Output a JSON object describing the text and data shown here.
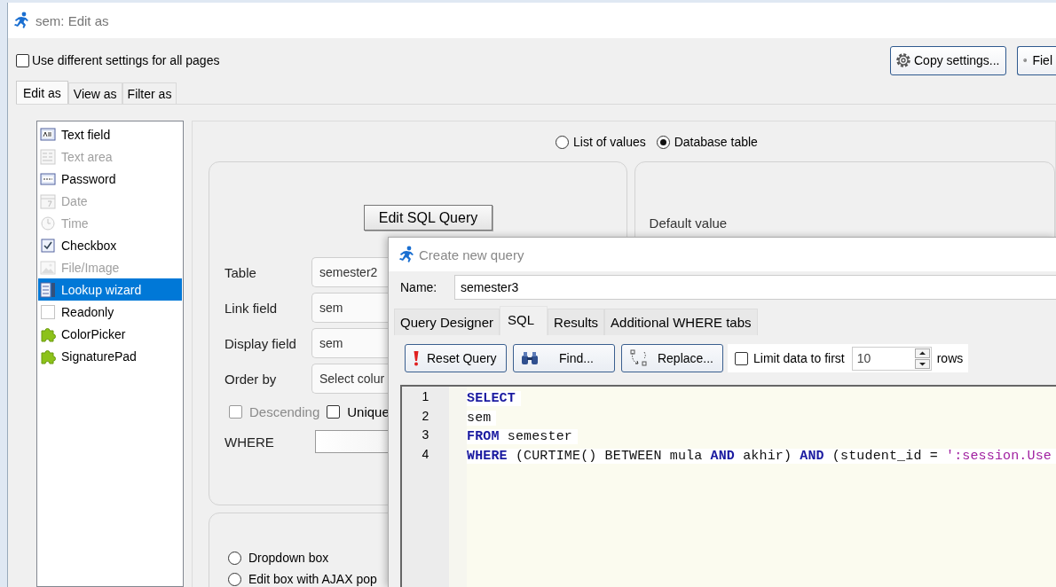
{
  "window": {
    "title": "sem: Edit as"
  },
  "use_different_settings": {
    "label": "Use different settings for all pages",
    "checked": false
  },
  "toolbar_buttons": [
    {
      "label": "Copy settings...",
      "kind": "gear"
    },
    {
      "label": "Fiel",
      "kind": "light"
    }
  ],
  "tabs": [
    {
      "label": "Edit as",
      "selected": true
    },
    {
      "label": "View as",
      "selected": false
    },
    {
      "label": "Filter as",
      "selected": false
    }
  ],
  "edit_types": [
    {
      "label": "Text field",
      "kind": "textfield",
      "disabled": false,
      "selected": false
    },
    {
      "label": "Text area",
      "kind": "textarea",
      "disabled": true,
      "selected": false
    },
    {
      "label": "Password",
      "kind": "password",
      "disabled": false,
      "selected": false
    },
    {
      "label": "Date",
      "kind": "date",
      "disabled": true,
      "selected": false
    },
    {
      "label": "Time",
      "kind": "time",
      "disabled": true,
      "selected": false
    },
    {
      "label": "Checkbox",
      "kind": "checkbox",
      "disabled": false,
      "selected": false
    },
    {
      "label": "File/Image",
      "kind": "image",
      "disabled": true,
      "selected": false
    },
    {
      "label": "Lookup wizard",
      "kind": "lookup",
      "disabled": false,
      "selected": true
    },
    {
      "label": "Readonly",
      "kind": "readonly",
      "disabled": false,
      "selected": false
    },
    {
      "label": "ColorPicker",
      "kind": "plugin",
      "disabled": false,
      "selected": false
    },
    {
      "label": "SignaturePad",
      "kind": "plugin",
      "disabled": false,
      "selected": false
    }
  ],
  "source": {
    "options": [
      {
        "label": "List of values",
        "selected": false
      },
      {
        "label": "Database table",
        "selected": true
      }
    ]
  },
  "lookup": {
    "edit_sql_button": "Edit SQL Query",
    "fields": [
      {
        "label": "Table",
        "value": "semester2"
      },
      {
        "label": "Link field",
        "value": "sem"
      },
      {
        "label": "Display field",
        "value": "sem"
      },
      {
        "label": "Order by",
        "value": "Select colur"
      }
    ],
    "checkboxes": [
      {
        "label": "Descending",
        "checked": false,
        "disabled": true
      },
      {
        "label": "Unique",
        "checked": false,
        "disabled": false
      }
    ],
    "where": {
      "label": "WHERE"
    }
  },
  "default_value": {
    "label": "Default value"
  },
  "display_options": [
    {
      "label": "Dropdown box",
      "selected": false
    },
    {
      "label": "Edit box with AJAX pop",
      "selected": false
    }
  ],
  "dialog": {
    "title": "Create new query",
    "name_label": "Name:",
    "name_value": "semester3",
    "tabs": [
      {
        "label": "Query Designer",
        "selected": false
      },
      {
        "label": "SQL",
        "selected": true
      },
      {
        "label": "Results",
        "selected": false
      },
      {
        "label": "Additional WHERE tabs",
        "selected": false
      }
    ],
    "buttons": [
      {
        "label": "Reset Query",
        "kind": "reset"
      },
      {
        "label": "Find...",
        "kind": "find"
      },
      {
        "label": "Replace...",
        "kind": "replace"
      }
    ],
    "limit": {
      "label": "Limit data to first",
      "checked": false,
      "value": "10",
      "unit": "rows"
    },
    "sql_lines": [
      {
        "number": "1",
        "tokens": [
          {
            "kind": "keyword",
            "text": "SELECT"
          }
        ]
      },
      {
        "number": "2",
        "tokens": [
          {
            "kind": "plain",
            "text": "sem"
          }
        ]
      },
      {
        "number": "3",
        "tokens": [
          {
            "kind": "keyword",
            "text": "FROM"
          },
          {
            "kind": "plain",
            "text": " semester"
          }
        ]
      },
      {
        "number": "4",
        "tokens": [
          {
            "kind": "keyword",
            "text": "WHERE"
          },
          {
            "kind": "plain",
            "text": " (CURTIME() BETWEEN mula "
          },
          {
            "kind": "keyword",
            "text": "AND"
          },
          {
            "kind": "plain",
            "text": " akhir) "
          },
          {
            "kind": "keyword",
            "text": "AND"
          },
          {
            "kind": "plain",
            "text": " (student_id = "
          },
          {
            "kind": "string",
            "text": "':session.Use"
          }
        ]
      }
    ]
  }
}
